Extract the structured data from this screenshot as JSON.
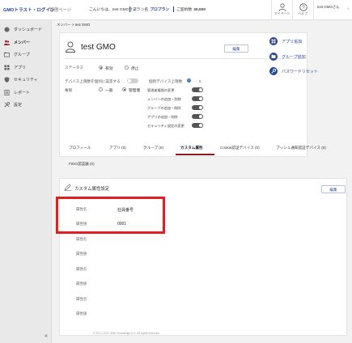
{
  "header": {
    "logo": "GMOトラスト・ログイン",
    "section": "管理ページ",
    "greeting": "こんにちは、test GMOさん",
    "plan_label": "プラン名",
    "plan_name": "プロプラン",
    "contract_label": "ご契約数",
    "contract_value": "20,000",
    "mypage_label": "マイページ",
    "help_label": "ヘルプ",
    "user_name": "test GMOさん"
  },
  "sidebar": {
    "items": [
      {
        "label": "ダッシュボード",
        "icon": "dashboard-icon"
      },
      {
        "label": "メンバー",
        "icon": "members-icon"
      },
      {
        "label": "グループ",
        "icon": "group-icon"
      },
      {
        "label": "アプリ",
        "icon": "apps-icon"
      },
      {
        "label": "セキュリティ",
        "icon": "shield-icon"
      },
      {
        "label": "レポート",
        "icon": "report-icon"
      },
      {
        "label": "設定",
        "icon": "settings-icon"
      }
    ],
    "active": "メンバー",
    "collapse": "«"
  },
  "breadcrumb": "メンバー > test GMO",
  "profile": {
    "name": "test GMO",
    "edit_label": "編集",
    "status_label": "ステータス",
    "status_options": [
      "有効",
      "停止"
    ],
    "status_selected": "有効",
    "device_limit_label": "デバイス上限数を個別に設定する",
    "device_limit_enabled": false,
    "device_count_label": "個別デバイス上限数",
    "device_count_value": "8",
    "role_label": "権限",
    "role_options": [
      "一般",
      "管理者"
    ],
    "role_selected": "管理者",
    "permissions": [
      {
        "label": "管理者権限の変更",
        "enabled": true
      },
      {
        "label": "メンバーの追加・削除",
        "enabled": true
      },
      {
        "label": "グループの追加・削除",
        "enabled": true
      },
      {
        "label": "アプリの追加・削除",
        "enabled": true
      },
      {
        "label": "セキュリティ設定の変更",
        "enabled": true
      }
    ]
  },
  "quick_actions": [
    {
      "label": "アプリ追加",
      "icon": "app-grid-icon"
    },
    {
      "label": "グループ追加",
      "icon": "folder-icon"
    },
    {
      "label": "パスワードリセット",
      "icon": "key-icon"
    }
  ],
  "tabs": [
    "プロフィール",
    "アプリ (0)",
    "グループ (0)",
    "カスタム属性",
    "Cookie認証デバイス (0)",
    "プッシュ通知認証デバイス (0)",
    "FIDO認証器 (0)"
  ],
  "active_tab": "カスタム属性",
  "custom_attributes": {
    "title": "カスタム属性設定",
    "edit_label": "編集",
    "rows": [
      {
        "name_label": "属性名",
        "name_value": "社員番号",
        "value_label": "属性値",
        "value_value": "0001"
      },
      {
        "name_label": "属性名",
        "name_value": "",
        "value_label": "属性値",
        "value_value": ""
      },
      {
        "name_label": "属性名",
        "name_value": "",
        "value_label": "属性値",
        "value_value": ""
      },
      {
        "name_label": "属性名",
        "name_value": "",
        "value_label": "属性値",
        "value_value": ""
      }
    ]
  },
  "footer": "© 2017-2023 GMO GlobalSign K.K. All rights reserved.",
  "colors": {
    "brand": "#1f3f8f",
    "highlight": "#e02020",
    "tab_active": "#8b1a1a"
  }
}
